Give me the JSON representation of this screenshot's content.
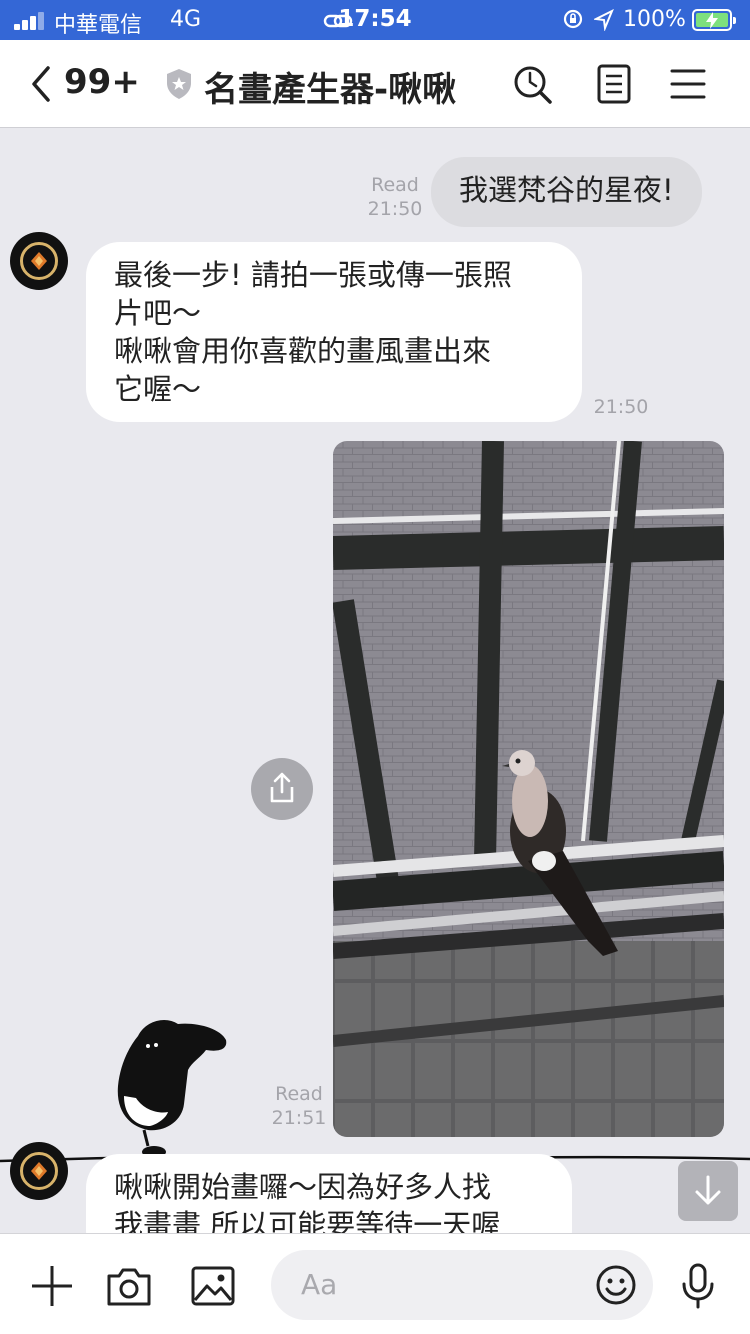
{
  "status_bar": {
    "carrier": "中華電信",
    "network": "4G",
    "link_icon": "link-icon",
    "time": "17:54",
    "battery_percent": "100%",
    "battery_color": "#7ee07e"
  },
  "header": {
    "back_icon": "chevron-left-icon",
    "unread_count": "99+",
    "title": "名畫產生器-啾啾",
    "search_icon": "search-icon",
    "notes_icon": "notes-icon",
    "menu_icon": "menu-icon"
  },
  "messages": [
    {
      "direction": "out",
      "text": "我選梵谷的星夜!",
      "read": "Read",
      "time": "21:50"
    },
    {
      "direction": "in",
      "lines": [
        "最後一步! 請拍一張或傳一張照",
        "片吧～",
        "啾啾會用你喜歡的畫風畫出來",
        "它喔～"
      ],
      "time": "21:50"
    },
    {
      "direction": "out",
      "type": "photo",
      "read": "Read",
      "time": "21:51"
    },
    {
      "direction": "in",
      "lines": [
        "啾啾開始畫囉～因為好多人找",
        "我畫畫 所以可能要等待一天喔"
      ]
    }
  ],
  "input": {
    "placeholder": "Aa"
  },
  "colors": {
    "status_bar": "#3467d6",
    "outgoing_bubble": "#dcdce0",
    "incoming_bubble": "#ffffff",
    "chat_background": "#e9e9ee"
  }
}
